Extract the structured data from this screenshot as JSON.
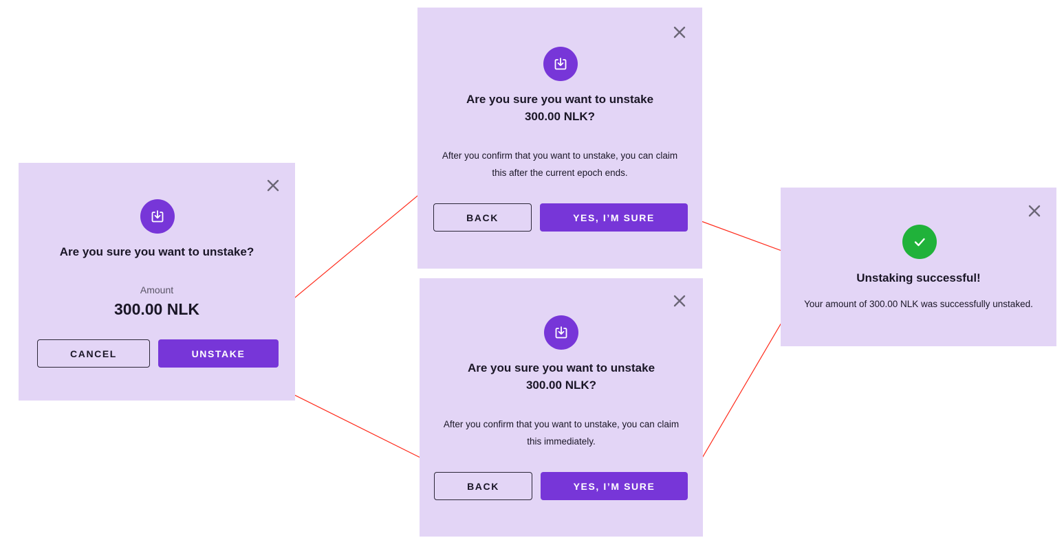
{
  "colors": {
    "dialog_bg": "#e3d5f6",
    "accent": "#7736d8",
    "success": "#20b23a",
    "arrow": "#ff2a1a"
  },
  "icons": {
    "close": "close-icon",
    "unstake": "download-tray-icon",
    "success": "checkmark-icon"
  },
  "dialog_initial": {
    "title": "Are you sure you want to unstake?",
    "amount_label": "Amount",
    "amount_value": "300.00 NLK",
    "cancel_label": "CANCEL",
    "unstake_label": "UNSTAKE"
  },
  "dialog_confirm_epoch": {
    "title_line1": "Are you sure you want to unstake",
    "title_line2": "300.00 NLK?",
    "body_line1": "After you confirm that you want to unstake, you can claim",
    "body_line2": "this after the current epoch ends.",
    "back_label": "BACK",
    "confirm_label": "YES, I’M SURE"
  },
  "dialog_confirm_immediate": {
    "title_line1": "Are you sure you want to unstake",
    "title_line2": "300.00 NLK?",
    "body_line1": "After you confirm that you want to unstake, you can claim",
    "body_line2": "this immediately.",
    "back_label": "BACK",
    "confirm_label": "YES, I’M SURE"
  },
  "dialog_success": {
    "title": "Unstaking successful!",
    "message": "Your amount of 300.00 NLK was successfully unstaked."
  }
}
